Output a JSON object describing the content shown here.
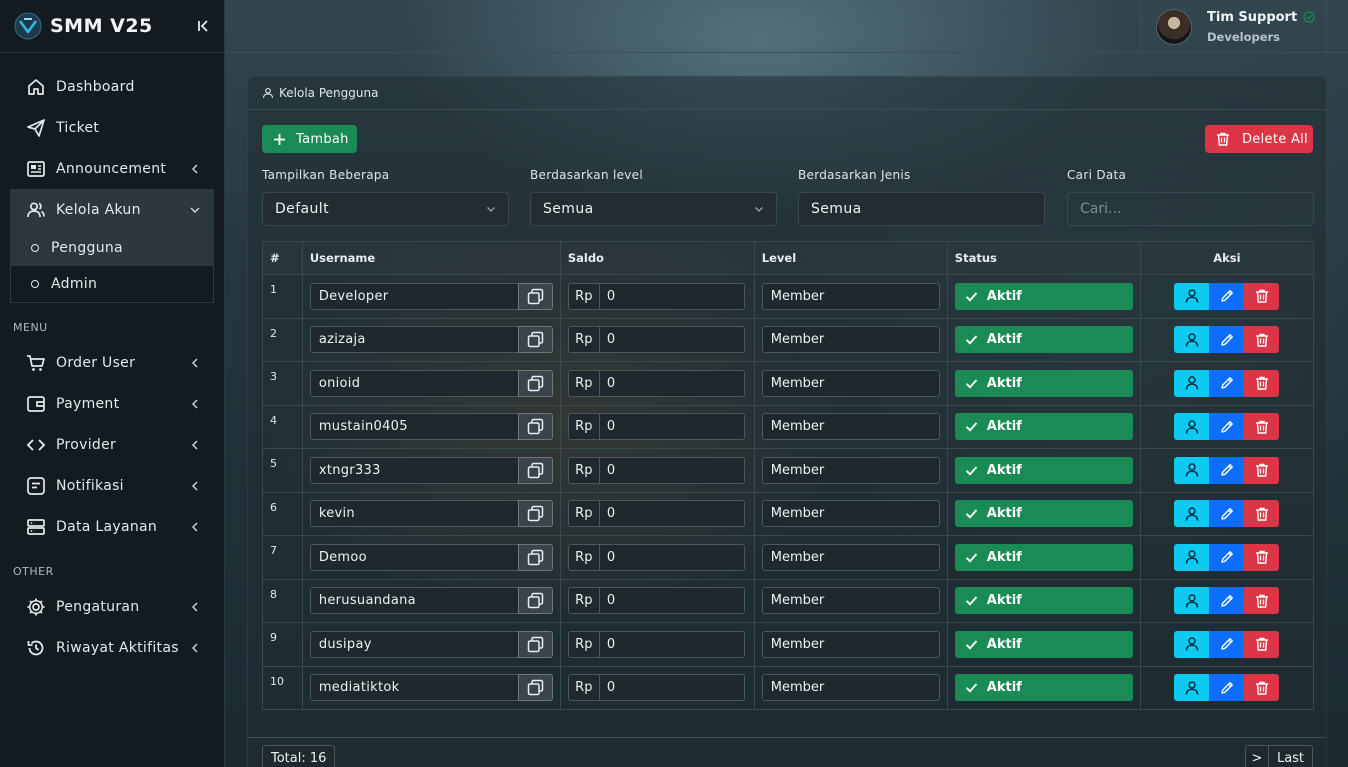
{
  "brand": {
    "name": "SMM V25"
  },
  "user": {
    "name": "Tim Support",
    "role": "Developers"
  },
  "sidebar": {
    "main": [
      {
        "label": "Dashboard",
        "icon": "home-icon"
      },
      {
        "label": "Ticket",
        "icon": "send-icon"
      },
      {
        "label": "Announcement",
        "icon": "newspaper-icon"
      }
    ],
    "kelola": {
      "label": "Kelola Akun",
      "icon": "users-icon"
    },
    "kelola_sub": [
      {
        "label": "Pengguna",
        "active": true
      },
      {
        "label": "Admin",
        "active": false
      }
    ],
    "menu_header": "MENU",
    "menu": [
      {
        "label": "Order User",
        "icon": "cart-icon"
      },
      {
        "label": "Payment",
        "icon": "wallet-icon"
      },
      {
        "label": "Provider",
        "icon": "code-icon"
      },
      {
        "label": "Notifikasi",
        "icon": "message-icon"
      },
      {
        "label": "Data Layanan",
        "icon": "server-icon"
      }
    ],
    "other_header": "OTHER",
    "other": [
      {
        "label": "Pengaturan",
        "icon": "gear-icon"
      },
      {
        "label": "Riwayat Aktifitas",
        "icon": "history-icon"
      }
    ]
  },
  "page": {
    "breadcrumb": "Kelola Pengguna",
    "add_label": "Tambah",
    "delete_all_label": "Delete All"
  },
  "filters": {
    "show": {
      "label": "Tampilkan Beberapa",
      "value": "Default"
    },
    "level": {
      "label": "Berdasarkan level",
      "value": "Semua"
    },
    "type": {
      "label": "Berdasarkan Jenis",
      "value": "Semua"
    },
    "search": {
      "label": "Cari Data",
      "placeholder": "Cari..."
    }
  },
  "table": {
    "headers": [
      "#",
      "Username",
      "Saldo",
      "Level",
      "Status",
      "Aksi"
    ],
    "currency": "Rp",
    "rows": [
      {
        "no": "1",
        "username": "Developer",
        "saldo": "0",
        "level": "Member",
        "status": "Aktif"
      },
      {
        "no": "2",
        "username": "azizaja",
        "saldo": "0",
        "level": "Member",
        "status": "Aktif"
      },
      {
        "no": "3",
        "username": "onioid",
        "saldo": "0",
        "level": "Member",
        "status": "Aktif"
      },
      {
        "no": "4",
        "username": "mustain0405",
        "saldo": "0",
        "level": "Member",
        "status": "Aktif"
      },
      {
        "no": "5",
        "username": "xtngr333",
        "saldo": "0",
        "level": "Member",
        "status": "Aktif"
      },
      {
        "no": "6",
        "username": "kevin",
        "saldo": "0",
        "level": "Member",
        "status": "Aktif"
      },
      {
        "no": "7",
        "username": "Demoo",
        "saldo": "0",
        "level": "Member",
        "status": "Aktif"
      },
      {
        "no": "8",
        "username": "herusuandana",
        "saldo": "0",
        "level": "Member",
        "status": "Aktif"
      },
      {
        "no": "9",
        "username": "dusipay",
        "saldo": "0",
        "level": "Member",
        "status": "Aktif"
      },
      {
        "no": "10",
        "username": "mediatiktok",
        "saldo": "0",
        "level": "Member",
        "status": "Aktif"
      }
    ]
  },
  "footer": {
    "total": "Total: 16",
    "next": ">",
    "last": "Last"
  },
  "colors": {
    "success": "#1b8b55",
    "danger": "#dc3545",
    "info": "#0dcaf0",
    "primary": "#0d6efd"
  }
}
